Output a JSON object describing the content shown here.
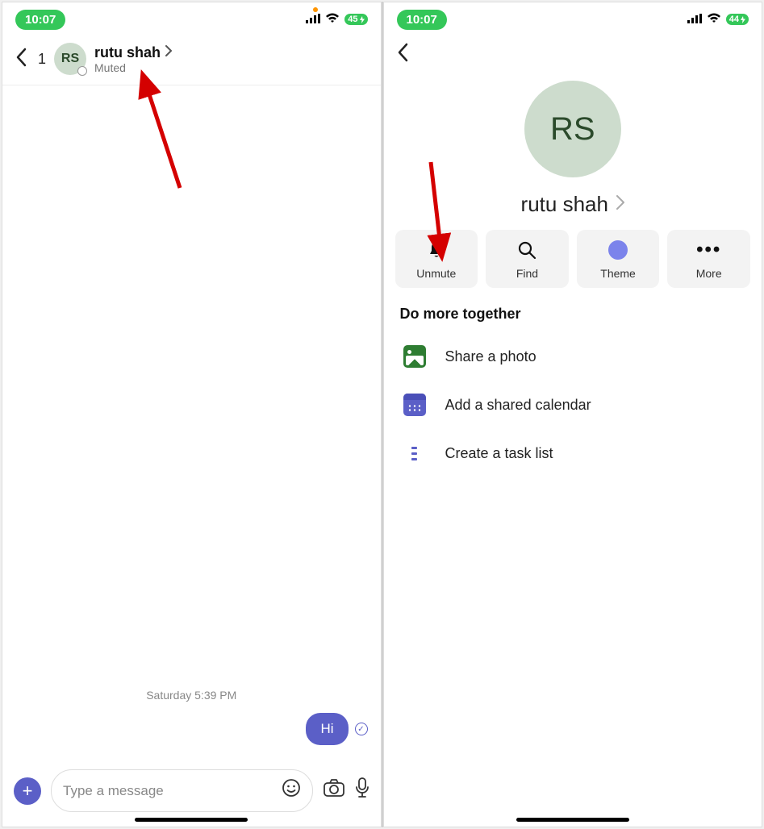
{
  "left": {
    "status": {
      "time": "10:07",
      "battery": "45"
    },
    "header": {
      "count": "1",
      "avatar_initials": "RS",
      "name": "rutu shah",
      "subtitle": "Muted"
    },
    "chat": {
      "timestamp": "Saturday 5:39 PM",
      "message": "Hi"
    },
    "compose": {
      "placeholder": "Type a message"
    }
  },
  "right": {
    "status": {
      "time": "10:07",
      "battery": "44"
    },
    "profile": {
      "avatar_initials": "RS",
      "name": "rutu shah"
    },
    "actions": {
      "unmute": "Unmute",
      "find": "Find",
      "theme": "Theme",
      "more": "More"
    },
    "section_title": "Do more together",
    "options": {
      "photo": "Share a photo",
      "calendar": "Add a shared calendar",
      "tasks": "Create a task list"
    }
  }
}
